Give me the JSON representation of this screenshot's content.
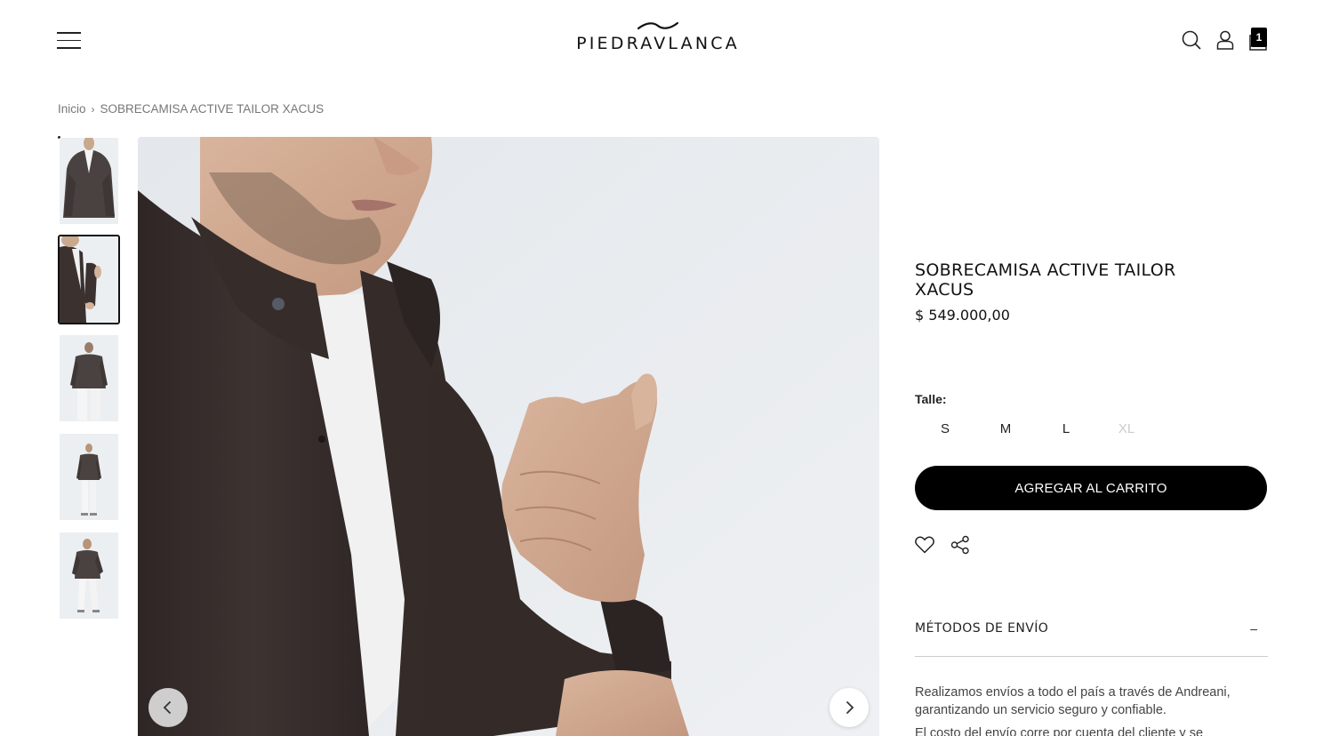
{
  "header": {
    "logo_text": "PIEDRAVLANCA",
    "cart_count": "1"
  },
  "breadcrumb": {
    "home": "Inicio",
    "separator": "›",
    "current": "SOBRECAMISA ACTIVE TAILOR XACUS"
  },
  "product": {
    "title": "SOBRECAMISA ACTIVE TAILOR XACUS",
    "price": "$ 549.000,00",
    "size_label": "Talle:",
    "sizes": [
      {
        "label": "S",
        "available": true
      },
      {
        "label": "M",
        "available": true
      },
      {
        "label": "L",
        "available": true
      },
      {
        "label": "XL",
        "available": false
      }
    ],
    "add_to_cart": "AGREGAR AL CARRITO"
  },
  "shipping": {
    "title": "MÉTODOS DE ENVÍO",
    "toggle": "–",
    "text_line1": "Realizamos envíos a todo el país a través de Andreani, garantizando un servicio seguro y confiable.",
    "text_line2": "El costo del envío corre por cuenta del cliente y se"
  },
  "colors": {
    "button_bg": "#000000",
    "button_text": "#ffffff",
    "shirt": "#3b3230",
    "background": "#e9ecef"
  },
  "gallery": {
    "active_index": 1,
    "thumb_count": 5
  }
}
